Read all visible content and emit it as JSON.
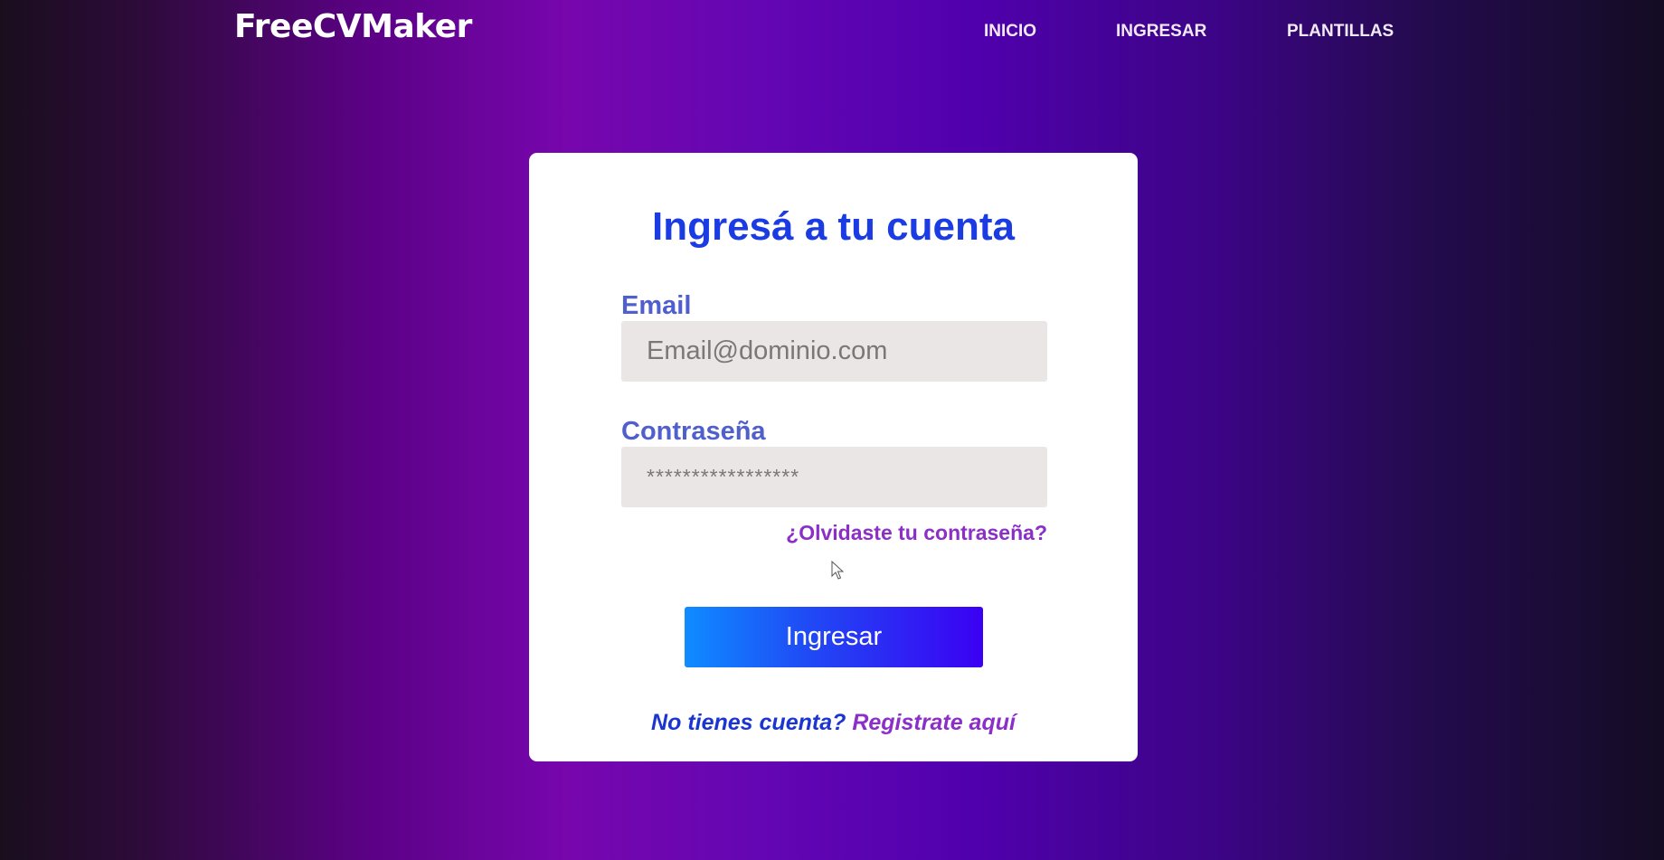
{
  "header": {
    "logo": "FreeCVMaker",
    "nav": [
      {
        "label": "INICIO"
      },
      {
        "label": "INGRESAR"
      },
      {
        "label": "PLANTILLAS"
      }
    ]
  },
  "login": {
    "title": "Ingresá a tu cuenta",
    "email_label": "Email",
    "email_placeholder": "Email@dominio.com",
    "password_label": "Contraseña",
    "password_placeholder": "*****************",
    "forgot_link": "¿Olvidaste tu contraseña?",
    "submit_label": "Ingresar",
    "register_question": "No tienes cuenta?",
    "register_link": "Registrate aquí"
  },
  "colors": {
    "title": "#1c3ce3",
    "label": "#4f5fcc",
    "link": "#8c2fc8",
    "button_start": "#0f8cff",
    "button_end": "#3b00f3",
    "input_bg": "#ebe6e6"
  },
  "icons": {
    "cursor": "mouse-pointer-icon"
  }
}
